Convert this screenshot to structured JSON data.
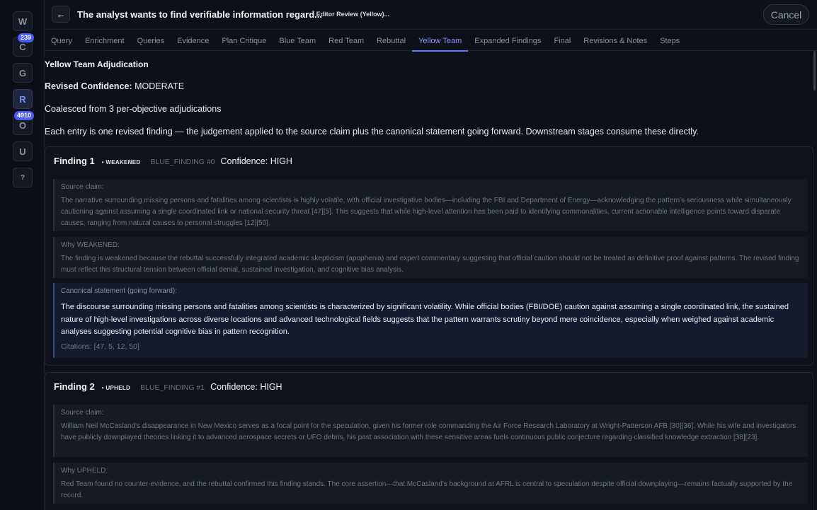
{
  "rail": {
    "items": [
      {
        "label": "W"
      },
      {
        "label": "C",
        "badge": "239"
      },
      {
        "label": "G"
      },
      {
        "label": "R",
        "active": true
      },
      {
        "label": "O",
        "badge": "4910"
      },
      {
        "label": "U"
      },
      {
        "label": "?"
      }
    ]
  },
  "header": {
    "back_icon": "←",
    "title": "The analyst wants to find verifiable information regard...",
    "status": "• Editor Review (Yellow)...",
    "cancel_label": "Cancel"
  },
  "tabs": [
    {
      "label": "Query"
    },
    {
      "label": "Enrichment"
    },
    {
      "label": "Queries"
    },
    {
      "label": "Evidence"
    },
    {
      "label": "Plan Critique"
    },
    {
      "label": "Blue Team"
    },
    {
      "label": "Red Team"
    },
    {
      "label": "Rebuttal"
    },
    {
      "label": "Yellow Team",
      "active": true
    },
    {
      "label": "Expanded Findings"
    },
    {
      "label": "Final"
    },
    {
      "label": "Revisions & Notes"
    },
    {
      "label": "Steps"
    }
  ],
  "main": {
    "section_title": "Yellow Team Adjudication",
    "revised_confidence_label": "Revised Confidence:",
    "revised_confidence_value": "MODERATE",
    "coalesced": "Coalesced from 3 per-objective adjudications",
    "description": "Each entry is one revised finding — the judgement applied to the source claim plus the canonical statement going forward. Downstream stages consume these directly."
  },
  "findings": [
    {
      "title": "Finding 1",
      "verdict": "• WEAKENED",
      "ref": "BLUE_FINDING #0",
      "confidence": "Confidence: HIGH",
      "source_label": "Source claim:",
      "source_text": "The narrative surrounding missing persons and fatalities among scientists is highly volatile, with official investigative bodies—including the FBI and Department of Energy—acknowledging the pattern's seriousness while simultaneously cautioning against assuming a single coordinated link or national security threat [47][5]. This suggests that while high-level attention has been paid to identifying commonalities, current actionable intelligence points toward disparate causes, ranging from natural causes to personal struggles [12][50].",
      "why_label": "Why WEAKENED:",
      "why_text": "The finding is weakened because the rebuttal successfully integrated academic skepticism (apophenia) and expert commentary suggesting that official caution should not be treated as definitive proof against patterns. The revised finding must reflect this structural tension between official denial, sustained investigation, and cognitive bias analysis.",
      "canon_label": "Canonical statement (going forward):",
      "canon_text": "The discourse surrounding missing persons and fatalities among scientists is characterized by significant volatility. While official bodies (FBI/DOE) caution against assuming a single coordinated link, the sustained nature of high-level investigations across diverse locations and advanced technological fields suggests that the pattern warrants scrutiny beyond mere coincidence, especially when weighed against academic analyses suggesting potential cognitive bias in pattern recognition.",
      "citations": "Citations: [47, 5, 12, 50]"
    },
    {
      "title": "Finding 2",
      "verdict": "• UPHELD",
      "ref": "BLUE_FINDING #1",
      "confidence": "Confidence: HIGH",
      "source_label": "Source claim:",
      "source_text": "William Neil McCasland's disappearance in New Mexico serves as a focal point for the speculation, given his former role commanding the Air Force Research Laboratory at Wright-Patterson AFB [30][36]. While his wife and investigators have publicly downplayed theories linking it to advanced aerospace secrets or UFO debris, his past association with these sensitive areas fuels continuous public conjecture regarding classified knowledge extraction [38][23].",
      "why_label": "Why UPHELD:",
      "why_text": "Red Team found no counter-evidence, and the rebuttal confirmed this finding stands. The core assertion—that McCasland's background at AFRL is central to speculation despite official downplaying—remains factually supported by the record."
    }
  ]
}
